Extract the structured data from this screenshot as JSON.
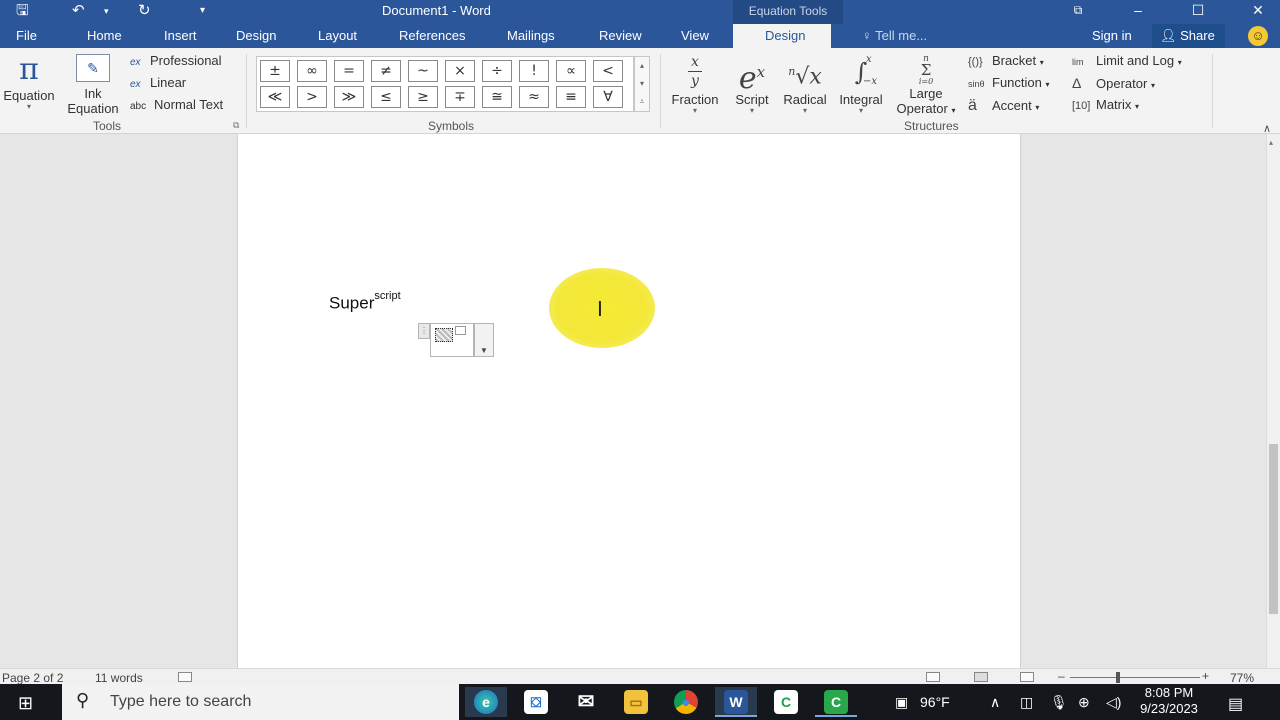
{
  "window": {
    "title": "Document1 - Word",
    "context_tab_group": "Equation Tools",
    "qat": {
      "save_icon": "save-icon",
      "undo_icon": "undo-icon",
      "redo_icon": "redo-icon",
      "customize_icon": "customize-icon"
    },
    "controls": {
      "restore_icon": "ribbon-display-options-icon",
      "minimize": "–",
      "maximize": "☐",
      "close": "✕"
    }
  },
  "tabs": [
    {
      "label": "File"
    },
    {
      "label": "Home"
    },
    {
      "label": "Insert"
    },
    {
      "label": "Design"
    },
    {
      "label": "Layout"
    },
    {
      "label": "References"
    },
    {
      "label": "Mailings"
    },
    {
      "label": "Review"
    },
    {
      "label": "View"
    },
    {
      "label": "Design",
      "active": true
    }
  ],
  "tell_me": "Tell me...",
  "sign_in": "Sign in",
  "share": "Share",
  "ribbon": {
    "tools": {
      "group_label": "Tools",
      "equation": {
        "glyph": "π",
        "label": "Equation"
      },
      "ink_equation": {
        "label1": "Ink",
        "label2": "Equation"
      },
      "professional": "Professional",
      "linear": "Linear",
      "normal_text": "Normal Text",
      "abc": "abc"
    },
    "symbols": {
      "group_label": "Symbols",
      "items": [
        "±",
        "∞",
        "=",
        "≠",
        "~",
        "×",
        "÷",
        "!",
        "∝",
        "<",
        "≪",
        ">",
        "≫",
        "≤",
        "≥",
        "∓",
        "≅",
        "≈",
        "≡",
        "∀"
      ]
    },
    "structures": {
      "group_label": "Structures",
      "fraction": {
        "label": "Fraction",
        "num": "x",
        "den": "y"
      },
      "script": {
        "label": "Script",
        "base": "e",
        "sup": "x"
      },
      "radical": {
        "label": "Radical",
        "index": "n",
        "body": "√x"
      },
      "integral": {
        "label": "Integral",
        "sign": "∫",
        "upper": "x",
        "lower": "−x"
      },
      "large_operator": {
        "label1": "Large",
        "label2": "Operator",
        "upper": "n",
        "sign": "Σ",
        "lower": "i=0"
      },
      "bracket": {
        "label": "Bracket",
        "icon": "{()}"
      },
      "function": {
        "label": "Function",
        "icon": "sinθ"
      },
      "accent": {
        "label": "Accent",
        "icon": "ä"
      },
      "limit_log": {
        "label": "Limit and Log",
        "icon": "lim"
      },
      "operator": {
        "label": "Operator",
        "icon": "Δ"
      },
      "matrix": {
        "label": "Matrix",
        "icon": "[10]"
      }
    }
  },
  "document": {
    "equation_base": "Super",
    "equation_superscript": "script"
  },
  "status": {
    "page": "Page 2 of 2",
    "words": "11 words",
    "zoom": "77%"
  },
  "taskbar": {
    "search_placeholder": "Type here to search",
    "weather": "96°F",
    "time": "8:08 PM",
    "date": "9/23/2023",
    "apps": [
      "edge-icon",
      "store-icon",
      "mail-icon",
      "file-explorer-icon",
      "chrome-icon",
      "word-icon",
      "camtasia-icon",
      "camtasia-recorder-icon"
    ]
  },
  "colors": {
    "accent": "#2b579a",
    "cursor_highlight": "#f5ea33",
    "taskbar": "#14181d"
  }
}
